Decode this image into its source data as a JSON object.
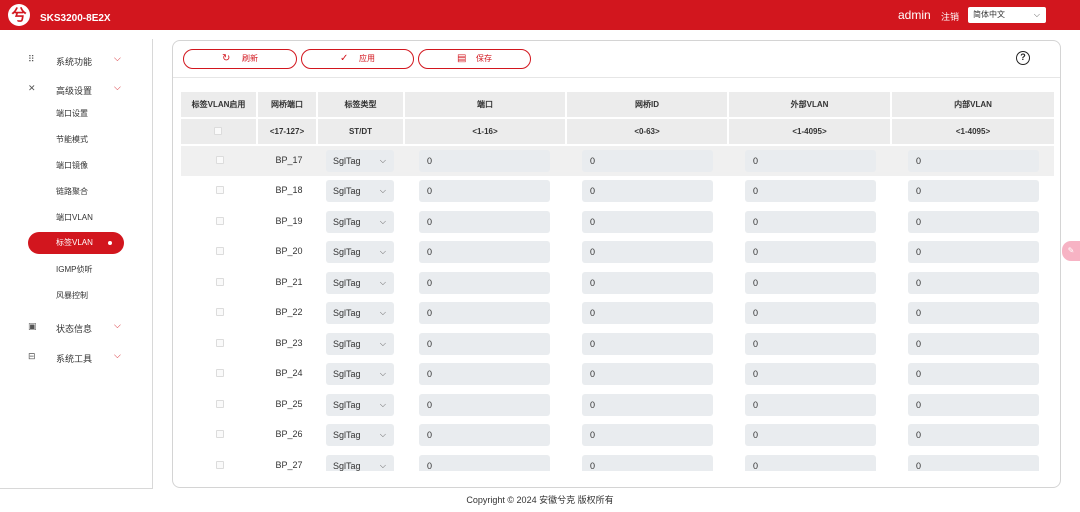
{
  "header": {
    "logo": "兮",
    "product": "SKS3200-8E2X",
    "user": "admin",
    "logout": "注销",
    "language": "简体中文"
  },
  "sidebar": {
    "groups": [
      {
        "label": "系统功能",
        "icon": "grid-icon"
      },
      {
        "label": "高级设置",
        "icon": "tools-icon"
      },
      {
        "label": "状态信息",
        "icon": "monitor-icon"
      },
      {
        "label": "系统工具",
        "icon": "toolbox-icon"
      }
    ],
    "advanced_items": [
      "端口设置",
      "节能模式",
      "端口镜像",
      "链路聚合",
      "端口VLAN",
      "标签VLAN",
      "IGMP侦听",
      "风暴控制"
    ]
  },
  "toolbar": {
    "refresh": "刷新",
    "apply": "应用",
    "save": "保存",
    "help": "?"
  },
  "table": {
    "headers": [
      "标签VLAN启用",
      "网桥端口",
      "标签类型",
      "端口",
      "网桥ID",
      "外部VLAN",
      "内部VLAN"
    ],
    "ranges": [
      "",
      "<17-127>",
      "ST/DT",
      "<1-16>",
      "<0-63>",
      "<1-4095>",
      "<1-4095>"
    ],
    "rows": [
      {
        "port": "BP_17",
        "type": "SglTag",
        "port_val": "0",
        "bridge_id": "0",
        "outer_vlan": "0",
        "inner_vlan": "0"
      },
      {
        "port": "BP_18",
        "type": "SglTag",
        "port_val": "0",
        "bridge_id": "0",
        "outer_vlan": "0",
        "inner_vlan": "0"
      },
      {
        "port": "BP_19",
        "type": "SglTag",
        "port_val": "0",
        "bridge_id": "0",
        "outer_vlan": "0",
        "inner_vlan": "0"
      },
      {
        "port": "BP_20",
        "type": "SglTag",
        "port_val": "0",
        "bridge_id": "0",
        "outer_vlan": "0",
        "inner_vlan": "0"
      },
      {
        "port": "BP_21",
        "type": "SglTag",
        "port_val": "0",
        "bridge_id": "0",
        "outer_vlan": "0",
        "inner_vlan": "0"
      },
      {
        "port": "BP_22",
        "type": "SglTag",
        "port_val": "0",
        "bridge_id": "0",
        "outer_vlan": "0",
        "inner_vlan": "0"
      },
      {
        "port": "BP_23",
        "type": "SglTag",
        "port_val": "0",
        "bridge_id": "0",
        "outer_vlan": "0",
        "inner_vlan": "0"
      },
      {
        "port": "BP_24",
        "type": "SglTag",
        "port_val": "0",
        "bridge_id": "0",
        "outer_vlan": "0",
        "inner_vlan": "0"
      },
      {
        "port": "BP_25",
        "type": "SglTag",
        "port_val": "0",
        "bridge_id": "0",
        "outer_vlan": "0",
        "inner_vlan": "0"
      },
      {
        "port": "BP_26",
        "type": "SglTag",
        "port_val": "0",
        "bridge_id": "0",
        "outer_vlan": "0",
        "inner_vlan": "0"
      },
      {
        "port": "BP_27",
        "type": "SglTag",
        "port_val": "0",
        "bridge_id": "0",
        "outer_vlan": "0",
        "inner_vlan": "0"
      }
    ]
  },
  "footer": "Copyright © 2024 安徽兮克 版权所有",
  "colors": {
    "brand": "#d2161e",
    "input_bg": "#e9ecef",
    "header_bg": "#ececec"
  }
}
